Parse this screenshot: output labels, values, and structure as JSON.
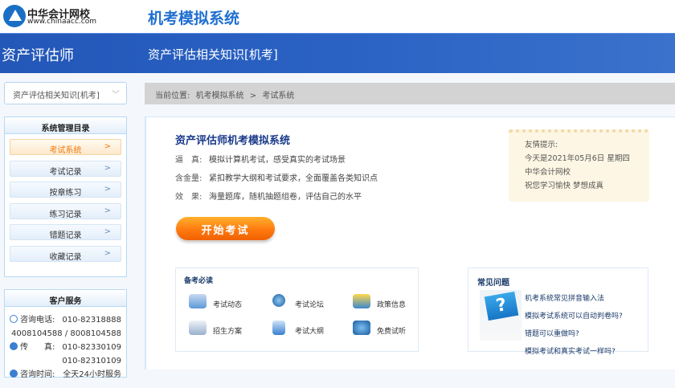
{
  "header": {
    "logo_name": "中华会计网校",
    "logo_url": "www.chinaacc.com",
    "system_title": "机考模拟系统"
  },
  "banner": {
    "category": "资产评估师",
    "subject": "资产评估相关知识[机考]"
  },
  "subject_select": {
    "value": "资产评估相关知识[机考]"
  },
  "breadcrumb": {
    "prefix": "当前位置:",
    "items": [
      "机考模拟系统",
      "考试系统"
    ],
    "separator": ">"
  },
  "sidebar": {
    "title": "系统管理目录",
    "items": [
      {
        "label": "考试系统",
        "active": true
      },
      {
        "label": "考试记录"
      },
      {
        "label": "按章练习"
      },
      {
        "label": "练习记录"
      },
      {
        "label": "错题记录"
      },
      {
        "label": "收藏记录"
      }
    ]
  },
  "customer_service": {
    "title": "客户服务",
    "phone_label": "咨询电话:",
    "phone": "010-82318888",
    "phone2": "4008104588 / 8008104588",
    "fax_label": "传　　真:",
    "fax": "010-82330109",
    "fax2": "010-82310109",
    "hours_label": "咨询时间:",
    "hours": "全天24小时服务"
  },
  "main": {
    "title": "资产评估师机考模拟系统",
    "features": [
      {
        "key": "逼　真:",
        "value": "模拟计算机考试，感受真实的考试场景"
      },
      {
        "key": "含金量:",
        "value": "紧扣教学大纲和考试要求，全面覆盖各类知识点"
      },
      {
        "key": "效　果:",
        "value": "海量题库，随机抽题组卷，评估自己的水平"
      }
    ],
    "start_button": "开始考试",
    "tip": [
      "友情提示:",
      "今天是2021年05月6日 星期四",
      "中华会计网校",
      "祝您学习愉快 梦想成真"
    ]
  },
  "must_read": {
    "title": "备考必读",
    "items": [
      "考试动态",
      "考试论坛",
      "政策信息",
      "招生方案",
      "考试大纲",
      "免费试听"
    ]
  },
  "faq": {
    "title": "常见问题",
    "items": [
      "机考系统常见拼音输入法",
      "模拟考试系统可以自动判卷吗?",
      "错题可以重做吗?",
      "模拟考试和真实考试一样吗?"
    ]
  }
}
